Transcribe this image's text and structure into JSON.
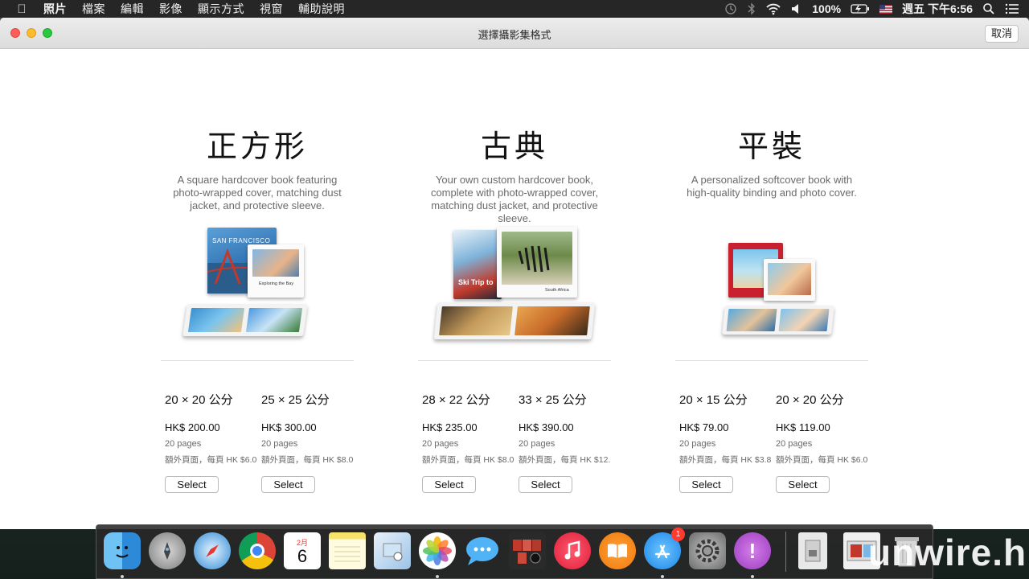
{
  "menubar": {
    "apple_icon": "apple-icon",
    "items": [
      "照片",
      "檔案",
      "編輯",
      "影像",
      "顯示方式",
      "視窗",
      "輔助說明"
    ],
    "battery": "100%",
    "clock": "週五 下午6:56"
  },
  "window": {
    "title": "選擇攝影集格式",
    "cancel_label": "取消"
  },
  "formats": [
    {
      "title": "正方形",
      "description": "A square hardcover book featuring photo-wrapped cover, matching dust jacket, and protective sleeve.",
      "options": [
        {
          "size": "20 × 20 公分",
          "price": "HK$ 200.00",
          "pages": "20 pages",
          "extra": "額外頁面，每頁 HK $6.0",
          "select_label": "Select"
        },
        {
          "size": "25 × 25 公分",
          "price": "HK$ 300.00",
          "pages": "20 pages",
          "extra": "額外頁面，每頁 HK $8.0",
          "select_label": "Select"
        }
      ]
    },
    {
      "title": "古典",
      "description": "Your own custom hardcover book, complete with photo-wrapped cover, matching dust jacket, and protective sleeve.",
      "options": [
        {
          "size": "28 × 22 公分",
          "price": "HK$ 235.00",
          "pages": "20 pages",
          "extra": "額外頁面，每頁 HK $8.0",
          "select_label": "Select"
        },
        {
          "size": "33 × 25 公分",
          "price": "HK$ 390.00",
          "pages": "20 pages",
          "extra": "額外頁面，每頁 HK $12.",
          "select_label": "Select"
        }
      ]
    },
    {
      "title": "平裝",
      "description": "A personalized softcover book with high-quality binding and photo cover.",
      "options": [
        {
          "size": "20 × 15 公分",
          "price": "HK$ 79.00",
          "pages": "20 pages",
          "extra": "額外頁面，每頁 HK $3.8",
          "select_label": "Select"
        },
        {
          "size": "20 × 20 公分",
          "price": "HK$ 119.00",
          "pages": "20 pages",
          "extra": "額外頁面，每頁 HK $6.0",
          "select_label": "Select"
        }
      ]
    }
  ],
  "book_art": {
    "square_cover_text": "SAN FRANCISCO",
    "square_page_text": "Exploring the Bay",
    "classic_cover_text": "Ski Trip to",
    "classic_page_text": "South Africa"
  },
  "dock": {
    "apps": [
      "Finder",
      "Launchpad",
      "Safari",
      "Chrome",
      "Calendar",
      "Notes",
      "Preview",
      "Photos",
      "Messages",
      "Photo Booth",
      "iTunes",
      "iBooks",
      "App Store",
      "System Preferences",
      "Feedback",
      "Archive",
      "Screenshot",
      "Trash"
    ],
    "calendar_month": "2月",
    "calendar_day": "6",
    "appstore_badge": "1"
  },
  "watermark": "unwire.hk"
}
